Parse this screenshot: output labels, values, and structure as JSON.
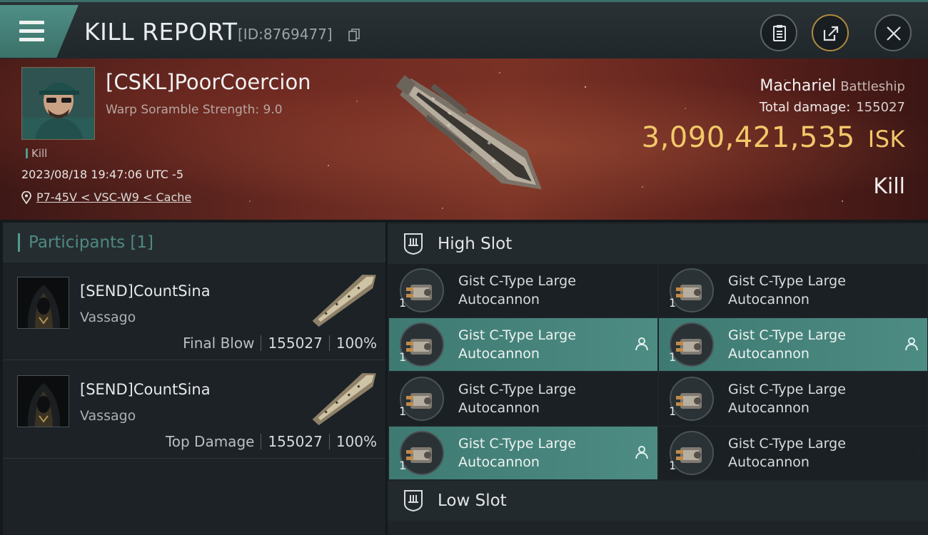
{
  "header": {
    "title": "KILL REPORT",
    "report_id": "[ID:8769477]",
    "icons": [
      "menu-icon",
      "copy-icon",
      "clipboard-icon",
      "share-icon",
      "close-icon"
    ]
  },
  "victim": {
    "name": "[CSKL]PoorCoercion",
    "scramble": "Warp Soramble Strength: 9.0",
    "tag": "Kill",
    "datetime": "2023/08/18 19:47:06 UTC -5",
    "location": "P7-45V < VSC-W9 < Cache",
    "ship": "Machariel",
    "ship_class": "Battleship",
    "total_damage_label": "Total damage:",
    "total_damage": "155027",
    "isk_value": "3,090,421,535",
    "isk_unit": "ISK",
    "result": "Kill"
  },
  "participants": {
    "header": "Participants [1]",
    "rows": [
      {
        "name": "[SEND]CountSina",
        "ship": "Vassago",
        "role": "Final Blow",
        "damage": "155027",
        "percent": "100%"
      },
      {
        "name": "[SEND]CountSina",
        "ship": "Vassago",
        "role": "Top Damage",
        "damage": "155027",
        "percent": "100%"
      }
    ]
  },
  "slots": {
    "high_label": "High Slot",
    "low_label": "Low Slot",
    "high": [
      {
        "line1": "Gist C-Type Large",
        "line2": "Autocannon",
        "qty": "1",
        "state": "destroyed"
      },
      {
        "line1": "Gist C-Type Large",
        "line2": "Autocannon",
        "qty": "1",
        "state": "destroyed"
      },
      {
        "line1": "Gist C-Type Large",
        "line2": "Autocannon",
        "qty": "1",
        "state": "dropped"
      },
      {
        "line1": "Gist C-Type Large",
        "line2": "Autocannon",
        "qty": "1",
        "state": "dropped"
      },
      {
        "line1": "Gist C-Type Large",
        "line2": "Autocannon",
        "qty": "1",
        "state": "destroyed"
      },
      {
        "line1": "Gist C-Type Large",
        "line2": "Autocannon",
        "qty": "1",
        "state": "destroyed"
      },
      {
        "line1": "Gist C-Type Large",
        "line2": "Autocannon",
        "qty": "1",
        "state": "dropped"
      },
      {
        "line1": "Gist C-Type Large",
        "line2": "Autocannon",
        "qty": "1",
        "state": "destroyed"
      }
    ]
  },
  "colors": {
    "accent_teal": "#4f9c8f",
    "isk_gold": "#f2c76a",
    "dropped_row": "#4d8c83"
  }
}
